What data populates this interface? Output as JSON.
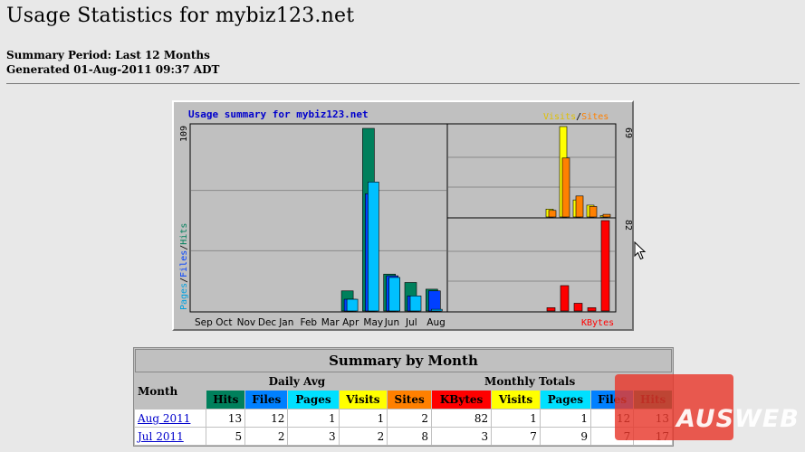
{
  "header": {
    "title": "Usage Statistics for mybiz123.net",
    "summary_period": "Summary Period: Last 12 Months",
    "generated": "Generated 01-Aug-2011 09:37 ADT"
  },
  "graph": {
    "title": "Usage summary for mybiz123.net",
    "legend_visits": "Visits",
    "legend_slash": "/",
    "legend_sites": "Sites",
    "legend_kbytes": "KBytes",
    "yaxis_pages": "Pages",
    "yaxis_files": "Files",
    "yaxis_hits": "Hits",
    "colors": {
      "hits": "#00805c",
      "files": "#0040ff",
      "pages": "#00c0ff",
      "visits": "#ffff00",
      "sites": "#ff8000",
      "kbytes": "#ff0000"
    }
  },
  "chart_data": {
    "type": "bar",
    "categories": [
      "Sep",
      "Oct",
      "Nov",
      "Dec",
      "Jan",
      "Feb",
      "Mar",
      "Apr",
      "May",
      "Jun",
      "Jul",
      "Aug"
    ],
    "main_ymax": 109,
    "visits_ymax": 69,
    "kbytes_ymax": 82,
    "series": [
      {
        "name": "Hits",
        "values": [
          0,
          0,
          0,
          0,
          0,
          0,
          0,
          12,
          109,
          22,
          17,
          13
        ]
      },
      {
        "name": "Files",
        "values": [
          0,
          0,
          0,
          0,
          0,
          0,
          0,
          7,
          70,
          21,
          9,
          12
        ]
      },
      {
        "name": "Pages",
        "values": [
          0,
          0,
          0,
          0,
          0,
          0,
          0,
          7,
          77,
          20,
          9,
          1
        ]
      },
      {
        "name": "Visits",
        "values": [
          0,
          0,
          0,
          0,
          0,
          0,
          0,
          6,
          69,
          13,
          9,
          1
        ]
      },
      {
        "name": "Sites",
        "values": [
          0,
          0,
          0,
          0,
          0,
          0,
          0,
          5,
          45,
          16,
          8,
          2
        ]
      },
      {
        "name": "KBytes",
        "values": [
          0,
          0,
          0,
          0,
          0,
          0,
          0,
          3,
          23,
          7,
          3,
          82
        ]
      }
    ]
  },
  "table": {
    "caption": "Summary by Month",
    "month_header": "Month",
    "daily_avg_header": "Daily Avg",
    "monthly_totals_header": "Monthly Totals",
    "columns": [
      {
        "label": "Hits",
        "color": "#00805c"
      },
      {
        "label": "Files",
        "color": "#0080ff"
      },
      {
        "label": "Pages",
        "color": "#00e0ff"
      },
      {
        "label": "Visits",
        "color": "#ffff00"
      },
      {
        "label": "Sites",
        "color": "#ff8000"
      },
      {
        "label": "KBytes",
        "color": "#ff0000"
      },
      {
        "label": "Visits",
        "color": "#ffff00"
      },
      {
        "label": "Pages",
        "color": "#00e0ff"
      },
      {
        "label": "Files",
        "color": "#0080ff"
      },
      {
        "label": "Hits",
        "color": "#00805c"
      }
    ],
    "rows": [
      {
        "month": "Aug 2011",
        "cells": [
          "13",
          "12",
          "1",
          "1",
          "2",
          "82",
          "1",
          "1",
          "12",
          "13"
        ]
      },
      {
        "month": "Jul 2011",
        "cells": [
          "5",
          "2",
          "3",
          "2",
          "8",
          "3",
          "7",
          "9",
          "7",
          "17"
        ]
      }
    ]
  },
  "watermark": {
    "text": "AUSWEB"
  }
}
